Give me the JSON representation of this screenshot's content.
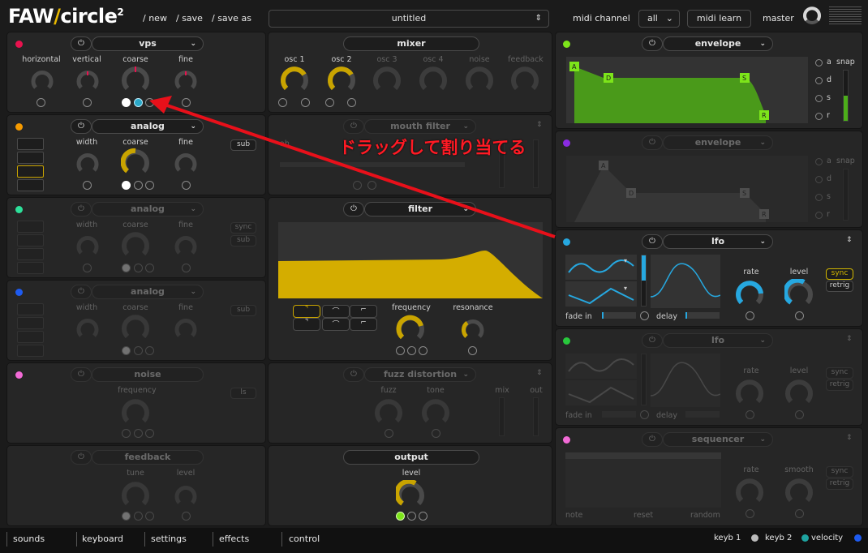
{
  "header": {
    "logo_faw": "FAW",
    "logo_slash": "/",
    "logo_circle": "circle",
    "logo_sup": "2",
    "new": "/ new",
    "save": "/ save",
    "save_as": "/ save as",
    "preset": "untitled",
    "midi_channel_label": "midi channel",
    "midi_channel_value": "all",
    "midi_learn": "midi learn",
    "master": "master"
  },
  "colors": {
    "accent_yellow": "#c9a400",
    "accent_teal": "#2aa8c8",
    "osc1_dot": "#e8124e",
    "osc2_dot": "#f59a00",
    "osc3_dot": "#2de09a",
    "osc4_dot": "#1e5bf0",
    "noise_dot": "#f26ad6",
    "env1_dot": "#7de51a",
    "env2_dot": "#8a2be2",
    "lfo1_dot": "#26a8e0",
    "lfo2_dot": "#28c83c",
    "seq_dot": "#f26ad6",
    "annotation_red": "#e8101a",
    "envelope_fill": "#4a9a1a"
  },
  "osc1": {
    "name": "vps",
    "labels": [
      "horizontal",
      "vertical",
      "coarse",
      "fine"
    ]
  },
  "osc2": {
    "name": "analog",
    "labels": [
      "width",
      "coarse",
      "fine"
    ],
    "sub": "sub"
  },
  "osc3": {
    "name": "analog",
    "labels": [
      "width",
      "coarse",
      "fine"
    ],
    "sync": "sync",
    "sub": "sub"
  },
  "osc4": {
    "name": "analog",
    "labels": [
      "width",
      "coarse",
      "fine"
    ],
    "sub": "sub"
  },
  "noise": {
    "name": "noise",
    "labels": [
      "frequency"
    ],
    "ls": "ls"
  },
  "feedback": {
    "name": "feedback",
    "labels": [
      "tune",
      "level"
    ]
  },
  "mixer": {
    "name": "mixer",
    "labels": [
      "osc 1",
      "osc 2",
      "osc 3",
      "osc 4",
      "noise",
      "feedback"
    ]
  },
  "mouth": {
    "name": "mouth filter",
    "ah": "ah"
  },
  "filter": {
    "name": "filter",
    "labels": [
      "frequency",
      "resonance"
    ]
  },
  "fuzz": {
    "name": "fuzz distortion",
    "labels": [
      "fuzz",
      "tone",
      "mix",
      "out"
    ]
  },
  "output": {
    "name": "output",
    "labels": [
      "level"
    ]
  },
  "env1": {
    "name": "envelope",
    "points": [
      "A",
      "D",
      "S",
      "R"
    ],
    "side": [
      "a",
      "d",
      "s",
      "r"
    ],
    "snap": "snap"
  },
  "env2": {
    "name": "envelope",
    "points": [
      "A",
      "D",
      "S",
      "R"
    ],
    "side": [
      "a",
      "d",
      "s",
      "r"
    ],
    "snap": "snap"
  },
  "lfo1": {
    "name": "lfo",
    "fade_in": "fade in",
    "delay": "delay",
    "labels": [
      "rate",
      "level"
    ],
    "sync": "sync",
    "retrig": "retrig"
  },
  "lfo2": {
    "name": "lfo",
    "fade_in": "fade in",
    "delay": "delay",
    "labels": [
      "rate",
      "level"
    ],
    "sync": "sync",
    "retrig": "retrig"
  },
  "seq": {
    "name": "sequencer",
    "labels": [
      "rate",
      "smooth"
    ],
    "sync": "sync",
    "retrig": "retrig",
    "bottom": [
      "note",
      "reset",
      "random"
    ]
  },
  "annotation": {
    "text": "ドラッグして割り当てる"
  },
  "footer": {
    "tabs": [
      "sounds",
      "keyboard",
      "settings",
      "effects",
      "control"
    ],
    "keyb1": "keyb 1",
    "keyb2": "keyb 2",
    "velocity": "velocity"
  }
}
